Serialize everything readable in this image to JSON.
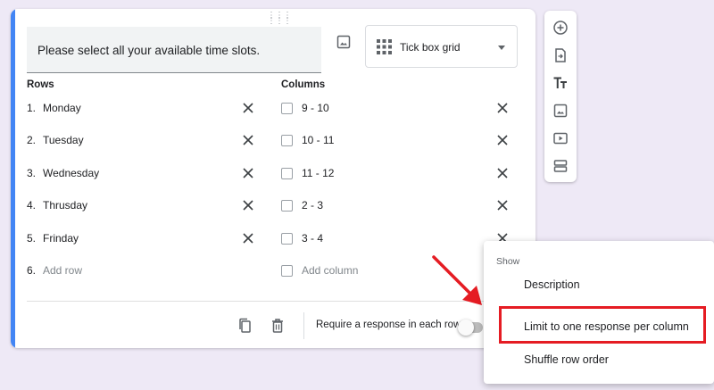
{
  "question": {
    "title": "Please select all your available time slots.",
    "type_label": "Tick box grid"
  },
  "rows": {
    "heading": "Rows",
    "items": [
      {
        "num": "1.",
        "label": "Monday"
      },
      {
        "num": "2.",
        "label": "Tuesday"
      },
      {
        "num": "3.",
        "label": "Wednesday"
      },
      {
        "num": "4.",
        "label": "Thrusday"
      },
      {
        "num": "5.",
        "label": "Frinday"
      }
    ],
    "add": {
      "num": "6.",
      "label": "Add row"
    }
  },
  "columns": {
    "heading": "Columns",
    "items": [
      "9 - 10",
      "10 - 11",
      "11 - 12",
      "2 - 3",
      "3 - 4"
    ],
    "add_label": "Add column"
  },
  "footer": {
    "require_label": "Require a response in each row",
    "require_on": false
  },
  "menu": {
    "section_label": "Show",
    "items": [
      "Description",
      "Limit to one response per column",
      "Shuffle row order"
    ],
    "highlighted_item": "Limit to one response per column"
  },
  "toolbar": {
    "icons": [
      "add-question-icon",
      "import-questions-icon",
      "add-title-icon",
      "add-image-icon",
      "add-video-icon",
      "add-section-icon"
    ]
  },
  "colors": {
    "accent": "#4285f4",
    "highlight": "#e51c23",
    "background": "#eee9f6"
  }
}
